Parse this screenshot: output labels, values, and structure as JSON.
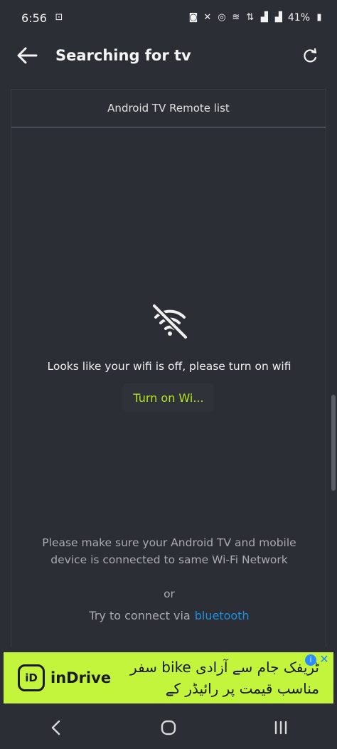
{
  "status_bar": {
    "time": "6:56",
    "battery": "41%"
  },
  "app_bar": {
    "title": "Searching for tv",
    "back_icon": "arrow-left-icon",
    "refresh_icon": "refresh-icon"
  },
  "list": {
    "header": "Android TV Remote list"
  },
  "empty_state": {
    "icon": "wifi-off-icon",
    "message": "Looks like your wifi is off, please turn on wifi",
    "button_label": "Turn on Wi...",
    "help_text": "Please make sure your Android TV and mobile device is connected to same Wi-Fi Network",
    "or_text": "or",
    "bt_prefix": "Try to connect via",
    "bt_link": "bluetooth"
  },
  "ad": {
    "logo_text": "iD",
    "brand": "inDrive",
    "line1": "سفر bike ٹریفک جام سے آزادی",
    "line2": "مناسب قیمت پر رائیڈر کے",
    "info_icon": "info-icon",
    "close_icon": "close-icon"
  },
  "colors": {
    "background": "#2b2e35",
    "accent_green": "#b5e61d",
    "link_blue": "#1e8fe0",
    "ad_background": "#c3f53c"
  },
  "nav": {
    "back_icon": "chevron-left-icon",
    "home_icon": "home-circle-icon",
    "recents_icon": "recents-icon"
  }
}
